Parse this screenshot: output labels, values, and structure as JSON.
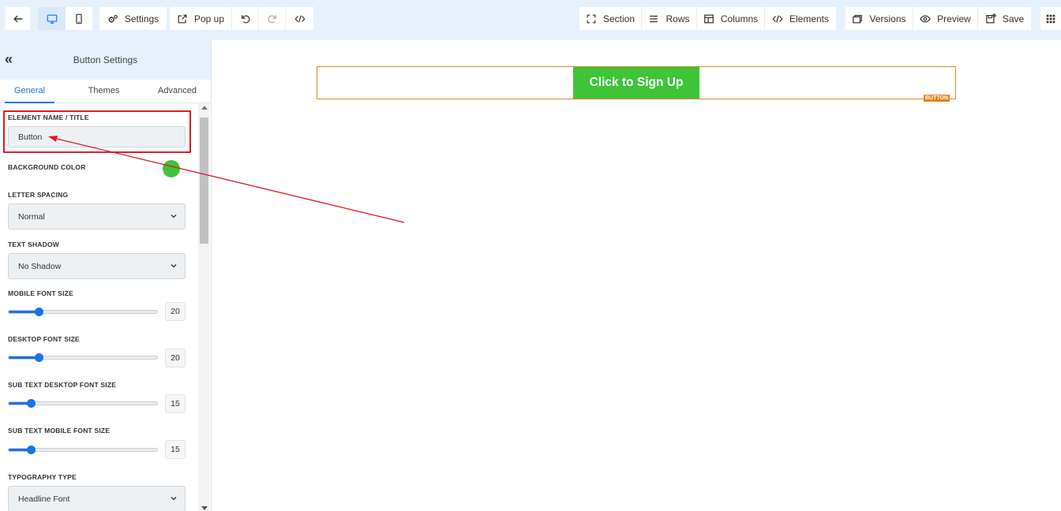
{
  "toolbar": {
    "settings_label": "Settings",
    "popup_label": "Pop up",
    "section_label": "Section",
    "rows_label": "Rows",
    "columns_label": "Columns",
    "elements_label": "Elements",
    "versions_label": "Versions",
    "preview_label": "Preview",
    "save_label": "Save"
  },
  "panel": {
    "title": "Button Settings",
    "tabs": [
      {
        "label": "General",
        "active": true
      },
      {
        "label": "Themes",
        "active": false
      },
      {
        "label": "Advanced",
        "active": false
      }
    ],
    "fields": {
      "element_name": {
        "label": "ELEMENT NAME / TITLE",
        "value": "Button"
      },
      "background_color": {
        "label": "BACKGROUND COLOR",
        "value": "#3fc43a"
      },
      "letter_spacing": {
        "label": "LETTER SPACING",
        "value": "Normal"
      },
      "text_shadow": {
        "label": "TEXT SHADOW",
        "value": "No Shadow"
      },
      "mobile_font_size": {
        "label": "MOBILE FONT SIZE",
        "value": "20",
        "fraction": 0.2
      },
      "desktop_font_size": {
        "label": "DESKTOP FONT SIZE",
        "value": "20",
        "fraction": 0.2
      },
      "sub_desktop_font_size": {
        "label": "SUB TEXT DESKTOP FONT SIZE",
        "value": "15",
        "fraction": 0.15
      },
      "sub_mobile_font_size": {
        "label": "SUB TEXT MOBILE FONT SIZE",
        "value": "15",
        "fraction": 0.15
      },
      "typography_type": {
        "label": "TYPOGRAPHY TYPE",
        "value": "Headline Font"
      }
    }
  },
  "canvas": {
    "button_text": "Click to Sign Up",
    "element_tag": "BUTTON"
  },
  "colors": {
    "accent": "#1a73e8",
    "button_green": "#3fc43a",
    "outline_orange": "#e6821e",
    "annotation_red": "#e01b24"
  }
}
